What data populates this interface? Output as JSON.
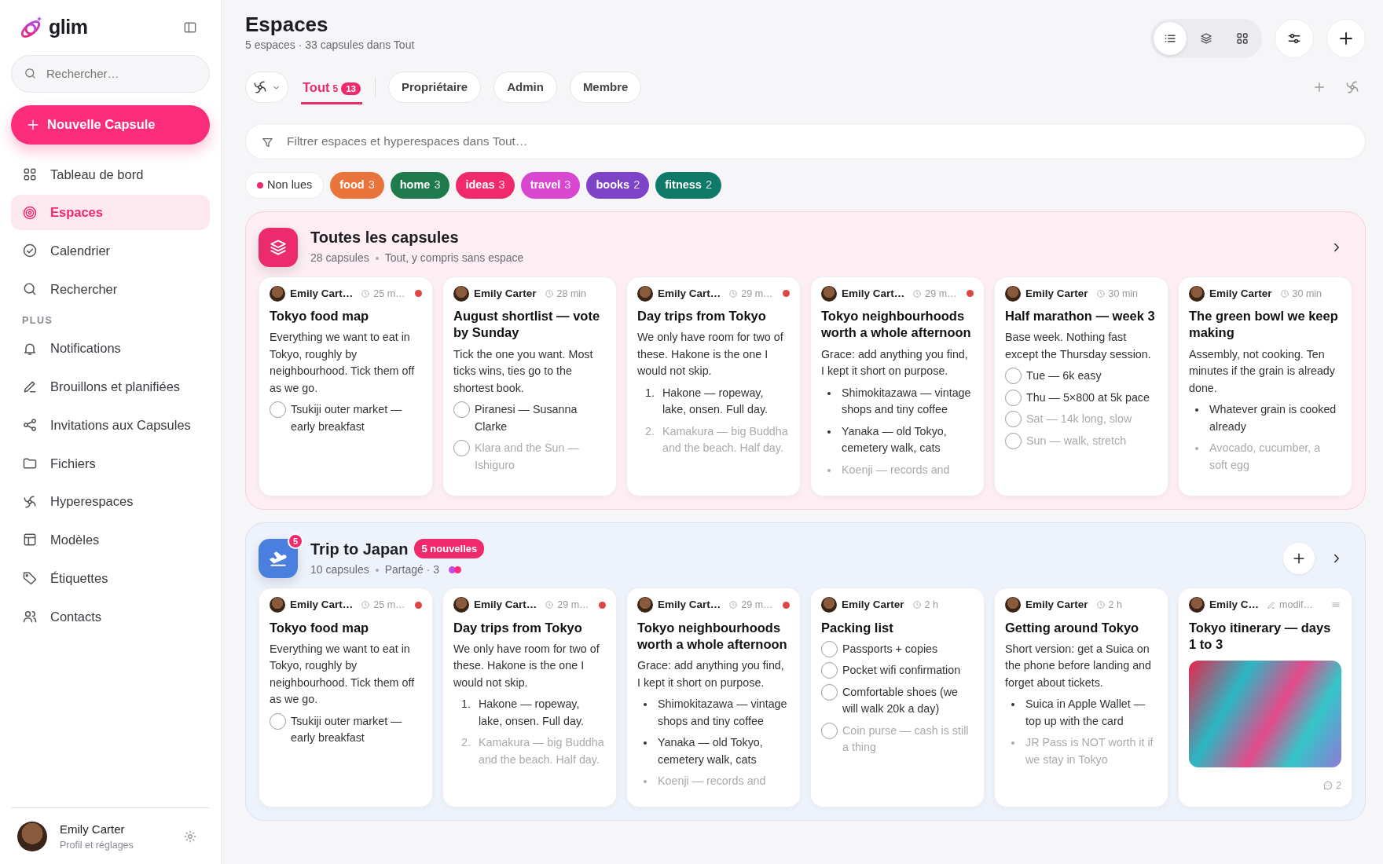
{
  "sidebar": {
    "brand": "glim",
    "search": {
      "placeholder": "Rechercher…"
    },
    "new_button": "Nouvelle Capsule",
    "items": [
      {
        "label": "Tableau de bord",
        "selected": false
      },
      {
        "label": "Espaces",
        "selected": true
      },
      {
        "label": "Calendrier",
        "selected": false
      },
      {
        "label": "Rechercher",
        "selected": false
      }
    ],
    "more_label": "PLUS",
    "more_items": [
      {
        "label": "Notifications",
        "selected": false
      },
      {
        "label": "Brouillons et planifiées",
        "selected": false
      },
      {
        "label": "Invitations aux Capsules",
        "selected": false
      },
      {
        "label": "Fichiers",
        "selected": false
      },
      {
        "label": "Hyperespaces",
        "selected": false
      },
      {
        "label": "Modèles",
        "selected": false
      },
      {
        "label": "Étiquettes",
        "selected": false
      },
      {
        "label": "Contacts",
        "selected": false
      }
    ],
    "user": {
      "name": "Emily Carter",
      "subtitle": "Profil et réglages"
    }
  },
  "header": {
    "title": "Espaces",
    "subtitle": "5 espaces · 33 capsules dans Tout",
    "views": [
      {
        "selected": true
      },
      {
        "selected": false
      },
      {
        "selected": false
      }
    ]
  },
  "tabs": [
    {
      "label": "Tout",
      "count": "5",
      "badge": "13",
      "selected": true
    },
    {
      "label": "Propriétaire",
      "selected": false
    },
    {
      "label": "Admin",
      "selected": false
    },
    {
      "label": "Membre",
      "selected": false
    }
  ],
  "filter": {
    "placeholder": "Filtrer espaces et hyperespaces dans Tout…"
  },
  "tags": [
    {
      "kind": "unread",
      "label": "Non lues",
      "color": "#f0286c"
    },
    {
      "kind": "tag",
      "label": "food",
      "count": "3",
      "color": "#e8743b"
    },
    {
      "kind": "tag",
      "label": "home",
      "count": "3",
      "color": "#1f7a4d"
    },
    {
      "kind": "tag",
      "label": "ideas",
      "count": "3",
      "color": "#f0286c"
    },
    {
      "kind": "tag",
      "label": "travel",
      "count": "3",
      "color": "#d946d0"
    },
    {
      "kind": "tag",
      "label": "books",
      "count": "2",
      "color": "#7e44c8"
    },
    {
      "kind": "tag",
      "label": "fitness",
      "count": "2",
      "color": "#0f7a68"
    }
  ],
  "sections": [
    {
      "kind": "all",
      "color": "#ec2a6e",
      "title": "Toutes les capsules",
      "meta": [
        "28 capsules",
        "Tout, y compris sans espace"
      ],
      "actions": [
        {
          "kind": "next"
        }
      ],
      "cards": [
        {
          "author": "Emily Cart…",
          "time": "25 m…",
          "kind": "recent",
          "unread": true,
          "title": "Tokyo food map",
          "blocks": [
            {
              "kind": "text",
              "text": "Everything we want to eat in Tokyo, roughly by neighbourhood. Tick them off as we go."
            },
            {
              "kind": "check",
              "checked": false,
              "faded": false,
              "text": "Tsukiji outer market — early breakfast"
            }
          ]
        },
        {
          "author": "Emily Carter",
          "time": "28 min",
          "kind": "recent",
          "unread": false,
          "title": "August shortlist — vote by Sunday",
          "blocks": [
            {
              "kind": "text",
              "text": "Tick the one you want. Most ticks wins, ties go to the shortest book."
            },
            {
              "kind": "check",
              "checked": false,
              "faded": false,
              "text": "Piranesi — Susanna Clarke"
            },
            {
              "kind": "check",
              "checked": false,
              "faded": true,
              "text": "Klara and the Sun — Ishiguro"
            }
          ]
        },
        {
          "author": "Emily Cart…",
          "time": "29 m…",
          "kind": "recent",
          "unread": true,
          "title": "Day trips from Tokyo",
          "blocks": [
            {
              "kind": "text",
              "text": "We only have room for two of these. Hakone is the one I would not skip."
            },
            {
              "kind": "number",
              "number": "1.",
              "faded": false,
              "text": "Hakone — ropeway, lake, onsen. Full day."
            },
            {
              "kind": "number",
              "number": "2.",
              "faded": true,
              "text": "Kamakura — big Buddha and the beach. Half day."
            }
          ]
        },
        {
          "author": "Emily Cart…",
          "time": "29 m…",
          "kind": "recent",
          "unread": true,
          "title": "Tokyo neighbourhoods worth a whole afternoon",
          "blocks": [
            {
              "kind": "text",
              "text": "Grace: add anything you find, I kept it short on purpose."
            },
            {
              "kind": "bullet",
              "faded": false,
              "text": "Shimokitazawa — vintage shops and tiny coffee"
            },
            {
              "kind": "bullet",
              "faded": false,
              "text": "Yanaka — old Tokyo, cemetery walk, cats"
            },
            {
              "kind": "bullet",
              "faded": true,
              "text": "Koenji — records and"
            }
          ]
        },
        {
          "author": "Emily Carter",
          "time": "30 min",
          "kind": "recent",
          "unread": false,
          "title": "Half marathon — week 3",
          "blocks": [
            {
              "kind": "text",
              "text": "Base week. Nothing fast except the Thursday session."
            },
            {
              "kind": "check",
              "checked": false,
              "faded": false,
              "text": "Tue — 6k easy"
            },
            {
              "kind": "check",
              "checked": false,
              "faded": false,
              "text": "Thu — 5×800 at 5k pace"
            },
            {
              "kind": "check",
              "checked": false,
              "faded": true,
              "text": "Sat — 14k long, slow"
            },
            {
              "kind": "check",
              "checked": false,
              "faded": true,
              "text": "Sun — walk, stretch"
            }
          ]
        },
        {
          "author": "Emily Carter",
          "time": "30 min",
          "kind": "recent",
          "unread": false,
          "title": "The green bowl we keep making",
          "blocks": [
            {
              "kind": "text",
              "text": "Assembly, not cooking. Ten minutes if the grain is already done."
            },
            {
              "kind": "bullet",
              "faded": false,
              "text": "Whatever grain is cooked already"
            },
            {
              "kind": "bullet",
              "faded": true,
              "text": "Avocado, cucumber, a soft egg"
            }
          ]
        }
      ]
    },
    {
      "kind": "space",
      "color": "#4a7fe0",
      "icon_count": "5",
      "title": "Trip to Japan",
      "badge": "5 nouvelles",
      "meta": [
        "10 capsules",
        "Partagé · 3"
      ],
      "members": [
        {
          "color": "#c04df0"
        },
        {
          "color": "#ff2d78"
        }
      ],
      "actions": [
        {
          "kind": "add"
        },
        {
          "kind": "next"
        }
      ],
      "cards": [
        {
          "author": "Emily Cart…",
          "time": "25 m…",
          "kind": "recent",
          "unread": true,
          "title": "Tokyo food map",
          "blocks": [
            {
              "kind": "text",
              "text": "Everything we want to eat in Tokyo, roughly by neighbourhood. Tick them off as we go."
            },
            {
              "kind": "check",
              "checked": false,
              "faded": false,
              "text": "Tsukiji outer market — early breakfast"
            }
          ]
        },
        {
          "author": "Emily Cart…",
          "time": "29 m…",
          "kind": "recent",
          "unread": true,
          "title": "Day trips from Tokyo",
          "blocks": [
            {
              "kind": "text",
              "text": "We only have room for two of these. Hakone is the one I would not skip."
            },
            {
              "kind": "number",
              "number": "1.",
              "faded": false,
              "text": "Hakone — ropeway, lake, onsen. Full day."
            },
            {
              "kind": "number",
              "number": "2.",
              "faded": true,
              "text": "Kamakura — big Buddha and the beach. Half day."
            }
          ]
        },
        {
          "author": "Emily Cart…",
          "time": "29 m…",
          "kind": "recent",
          "unread": true,
          "title": "Tokyo neighbourhoods worth a whole afternoon",
          "blocks": [
            {
              "kind": "text",
              "text": "Grace: add anything you find, I kept it short on purpose."
            },
            {
              "kind": "bullet",
              "faded": false,
              "text": "Shimokitazawa — vintage shops and tiny coffee"
            },
            {
              "kind": "bullet",
              "faded": false,
              "text": "Yanaka — old Tokyo, cemetery walk, cats"
            },
            {
              "kind": "bullet",
              "faded": true,
              "text": "Koenji — records and"
            }
          ]
        },
        {
          "author": "Emily Carter",
          "time": "2 h",
          "kind": "recent",
          "unread": false,
          "title": "Packing list",
          "blocks": [
            {
              "kind": "check",
              "checked": false,
              "faded": false,
              "text": "Passports + copies"
            },
            {
              "kind": "check",
              "checked": false,
              "faded": false,
              "text": "Pocket wifi confirmation"
            },
            {
              "kind": "check",
              "checked": false,
              "faded": false,
              "text": "Comfortable shoes (we will walk 20k a day)"
            },
            {
              "kind": "check",
              "checked": false,
              "faded": true,
              "text": "Coin purse — cash is still a thing"
            }
          ]
        },
        {
          "author": "Emily Carter",
          "time": "2 h",
          "kind": "recent",
          "unread": false,
          "title": "Getting around Tokyo",
          "blocks": [
            {
              "kind": "text",
              "text": "Short version: get a Suica on the phone before landing and forget about tickets."
            },
            {
              "kind": "bullet",
              "faded": false,
              "text": "Suica in Apple Wallet — top up with the card"
            },
            {
              "kind": "bullet",
              "faded": true,
              "text": "JR Pass is NOT worth it if we stay in Tokyo"
            }
          ]
        },
        {
          "author": "Emily C…",
          "time": "modif…",
          "kind": "edited",
          "unread": false,
          "title": "Tokyo itinerary — days 1 to 3",
          "blocks": [
            {
              "kind": "photo"
            }
          ],
          "comments": "2"
        }
      ]
    }
  ]
}
